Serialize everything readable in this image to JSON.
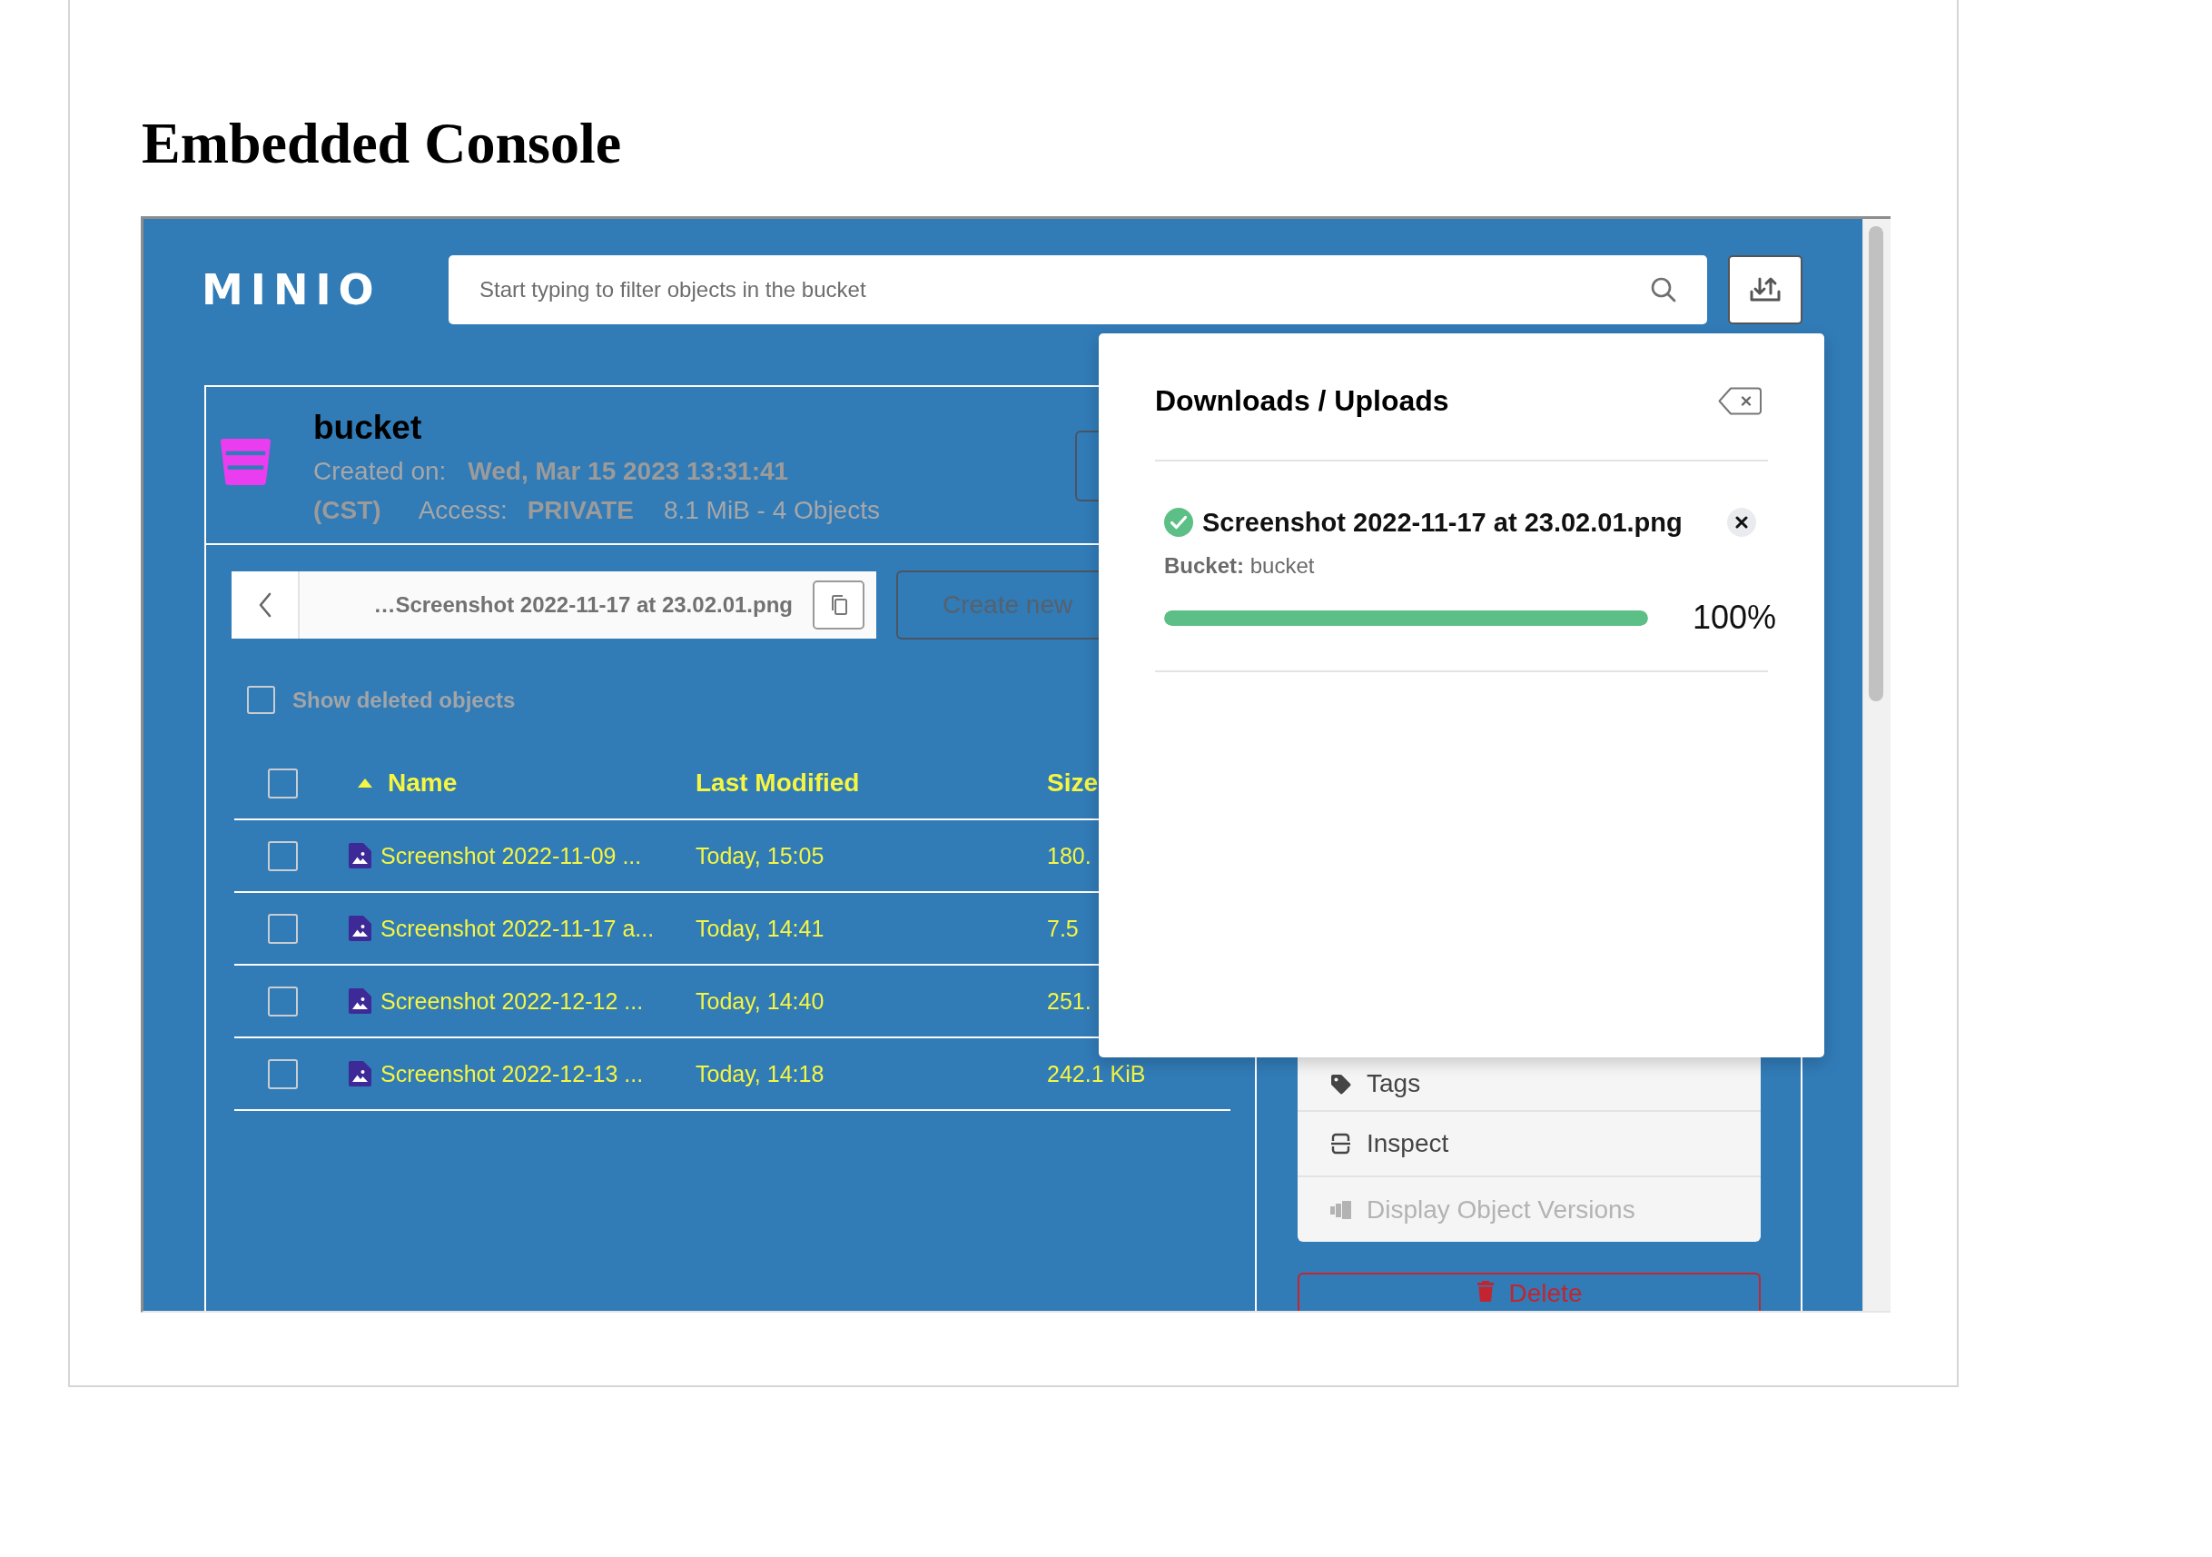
{
  "page_title": "Embedded Console",
  "console": {
    "logo": "MINIO",
    "search": {
      "placeholder": "Start typing to filter objects in the bucket"
    },
    "bucket": {
      "name": "bucket",
      "created_label": "Created on:",
      "created_value": "Wed, Mar 15 2023 13:31:41",
      "timezone": "(CST)",
      "access_label": "Access:",
      "access_value": "PRIVATE",
      "usage": "8.1 MiB - 4 Objects"
    },
    "breadcrumb": {
      "path": "…Screenshot 2022-11-17 at 23.02.01.png"
    },
    "create_button": {
      "label": "Create new"
    },
    "show_deleted": {
      "label": "Show deleted objects",
      "checked": false
    },
    "table": {
      "select_all": {
        "checked": false
      },
      "columns": [
        {
          "label": "Name",
          "sorted": true
        },
        {
          "label": "Last Modified",
          "sorted": false
        },
        {
          "label": "Size",
          "sorted": false
        }
      ],
      "rows": [
        {
          "name": "Screenshot 2022-11-09 ...",
          "modified": "Today, 15:05",
          "size": "180.",
          "checked": false
        },
        {
          "name": "Screenshot 2022-11-17 a...",
          "modified": "Today, 14:41",
          "size": "7.5",
          "checked": false
        },
        {
          "name": "Screenshot 2022-12-12 ...",
          "modified": "Today, 14:40",
          "size": "251.",
          "checked": false
        },
        {
          "name": "Screenshot 2022-12-13 ...",
          "modified": "Today, 14:18",
          "size": "242.1 KiB",
          "checked": false
        }
      ]
    },
    "object_actions": [
      {
        "kind": "tags",
        "label": "Tags",
        "disabled": false
      },
      {
        "kind": "inspect",
        "label": "Inspect",
        "disabled": false
      },
      {
        "kind": "versions",
        "label": "Display Object Versions",
        "disabled": true
      }
    ],
    "delete_button": {
      "label": "Delete"
    },
    "transfers": {
      "title": "Downloads / Uploads",
      "items": [
        {
          "file": "Screenshot 2022-11-17 at 23.02.01.png",
          "completed": true,
          "bucket": "**Bucket:** bucket",
          "level": 1,
          "percent": "100%"
        }
      ]
    }
  }
}
